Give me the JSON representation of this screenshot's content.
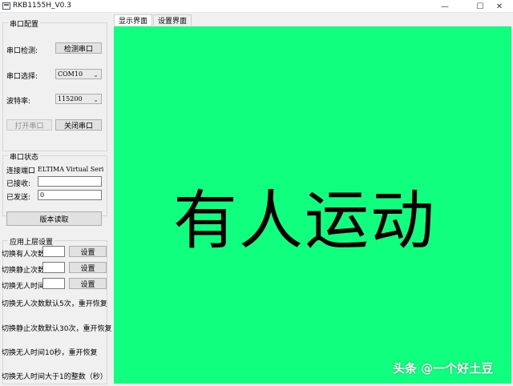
{
  "window": {
    "title": "RKB1155H_V0.3",
    "minimize_glyph": "—",
    "maximize_glyph": "☐",
    "close_glyph": "✕"
  },
  "serial_config": {
    "title": "串口配置",
    "detect_label": "串口检测:",
    "detect_button": "检测串口",
    "select_label": "串口选择:",
    "port_value": "COM10",
    "baud_label": "波特率:",
    "baud_value": "115200",
    "open_button": "打开串口",
    "close_button": "关闭串口"
  },
  "serial_status": {
    "title": "串口状态",
    "port_label": "连接端口",
    "port_value": "ELTIMA Virtual Seria",
    "received_label": "已接收:",
    "received_value": "765469",
    "sent_label": "已发送:",
    "sent_value": "0"
  },
  "version_button": "版本读取",
  "app_settings": {
    "title": "应用上层设置",
    "rows": [
      {
        "label": "切换有人次数",
        "value": "",
        "button": "设置"
      },
      {
        "label": "切换静止次数",
        "value": "",
        "button": "设置"
      },
      {
        "label": "切换无人时间",
        "value": "",
        "button": "设置"
      }
    ],
    "notes": [
      "切换无人次数默认5次，重开恢复",
      "切换静止次数默认30次，重开恢复",
      "切换无人时间10秒，重开恢复",
      "切换无人时间大于1的整数（秒）"
    ]
  },
  "tabs": [
    {
      "label": "显示界面",
      "active": true
    },
    {
      "label": "设置界面",
      "active": false
    }
  ],
  "display": {
    "status_text": "有人运动",
    "background_color": "#10ff7e"
  },
  "watermark": "头条 @一个好土豆",
  "colors": {
    "display_bg": "#10ff7e",
    "window_bg": "#f0f0f0"
  }
}
